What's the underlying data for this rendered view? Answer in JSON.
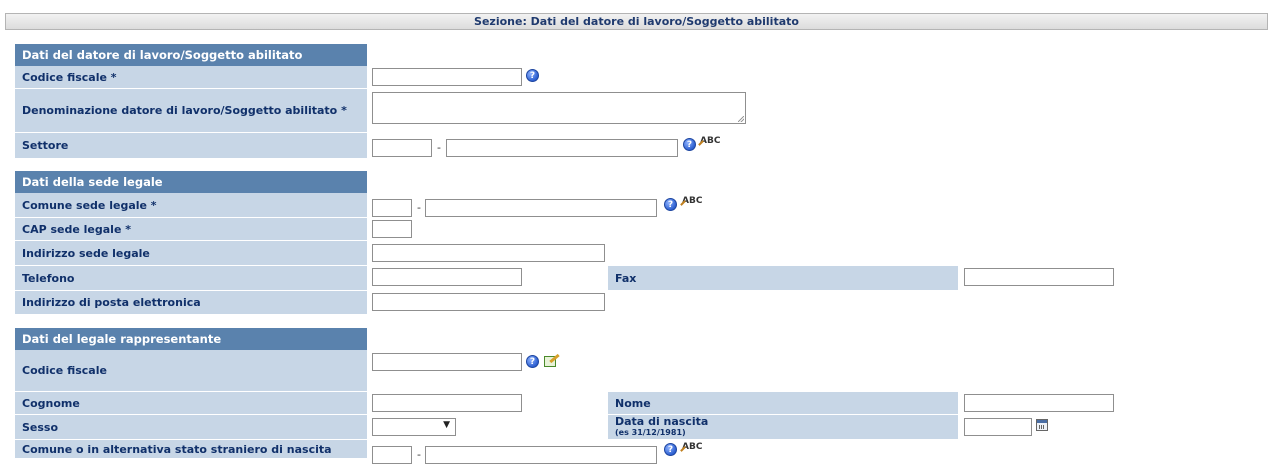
{
  "section_title": "Sezione: Dati del datore di lavoro/Soggetto abilitato",
  "employer": {
    "header": "Dati del datore di lavoro/Soggetto abilitato",
    "codice_fiscale": "Codice fiscale *",
    "denominazione": "Denominazione datore di lavoro/Soggetto abilitato *",
    "settore": "Settore"
  },
  "sede_legale": {
    "header": "Dati della sede legale",
    "comune": "Comune sede legale *",
    "cap": "CAP sede legale *",
    "indirizzo": "Indirizzo sede legale",
    "telefono": "Telefono",
    "fax": "Fax",
    "email": "Indirizzo di posta elettronica"
  },
  "legale_rappresentante": {
    "header": "Dati del legale rappresentante",
    "codice_fiscale": "Codice fiscale",
    "cognome": "Cognome",
    "nome": "Nome",
    "sesso": "Sesso",
    "data_nascita": "Data di nascita",
    "data_nascita_hint": "(es 31/12/1981)",
    "comune_nascita": "Comune o in alternativa stato straniero di nascita"
  },
  "glyphs": {
    "dash": "-",
    "help": "?",
    "abc": "ABC",
    "dropdown_arrow": "▼"
  },
  "icons": {
    "help": "question-circle-icon",
    "search": "abc-lookup-icon",
    "calendar": "calendar-icon",
    "edit": "edit-icon"
  }
}
